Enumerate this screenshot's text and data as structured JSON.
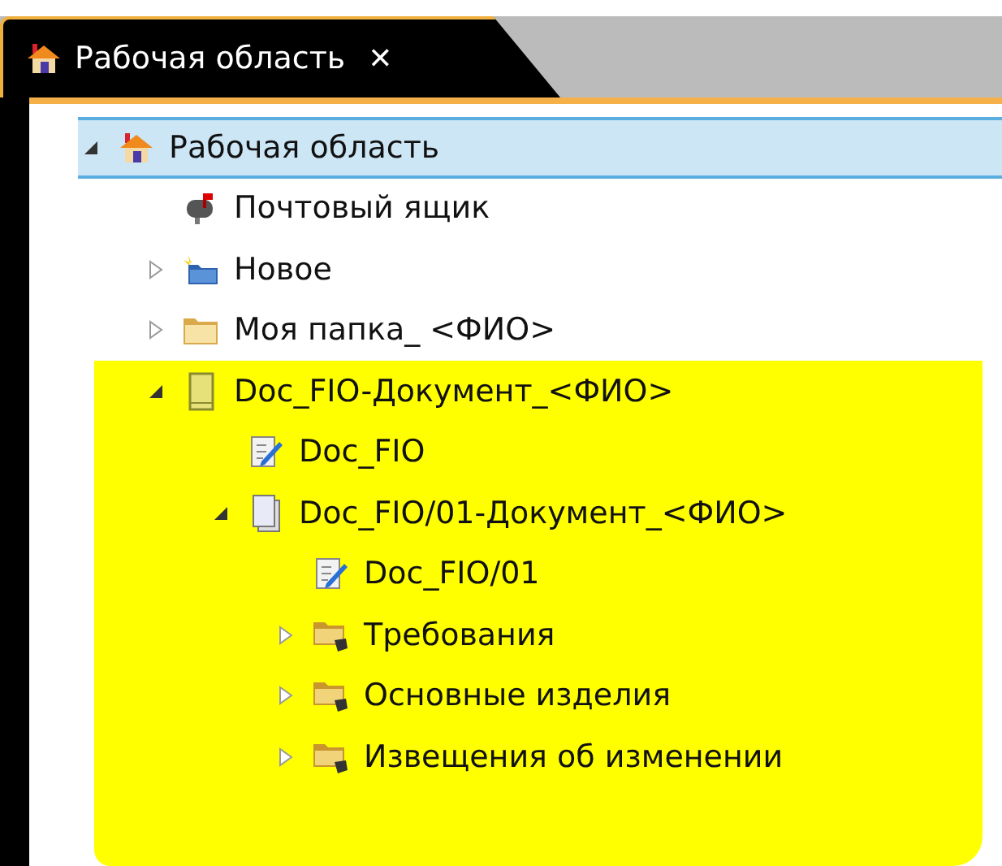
{
  "tab": {
    "title": "Рабочая область",
    "close": "✕"
  },
  "tree": [
    {
      "label": "Рабочая область",
      "kind": "workspace",
      "expanded": true,
      "selected": true,
      "highlighted": false,
      "children": [
        {
          "label": "Почтовый ящик",
          "kind": "mailbox",
          "selected": false,
          "highlighted": false
        },
        {
          "label": "Новое",
          "kind": "new-folder",
          "expanded": false,
          "selected": false,
          "highlighted": false
        },
        {
          "label": "Моя папка_ <ФИО>",
          "kind": "folder",
          "expanded": false,
          "selected": false,
          "highlighted": false
        },
        {
          "label": "Doc_FIO-Документ_<ФИО>",
          "kind": "document",
          "expanded": true,
          "selected": false,
          "highlighted": true,
          "children": [
            {
              "label": "Doc_FIO",
              "kind": "edit-doc",
              "selected": false,
              "highlighted": false
            },
            {
              "label": "Doc_FIO/01-Документ_<ФИО>",
              "kind": "doc-version",
              "expanded": true,
              "selected": false,
              "highlighted": false,
              "children": [
                {
                  "label": "Doc_FIO/01",
                  "kind": "edit-doc",
                  "selected": false,
                  "highlighted": false
                },
                {
                  "label": "Требования",
                  "kind": "linked-folder",
                  "expanded": false,
                  "selected": false,
                  "highlighted": false
                },
                {
                  "label": "Основные изделия",
                  "kind": "linked-folder",
                  "expanded": false,
                  "selected": false,
                  "highlighted": false
                },
                {
                  "label": "Извещения об изменении",
                  "kind": "linked-folder",
                  "expanded": false,
                  "selected": false,
                  "highlighted": false
                }
              ]
            }
          ]
        }
      ]
    }
  ]
}
